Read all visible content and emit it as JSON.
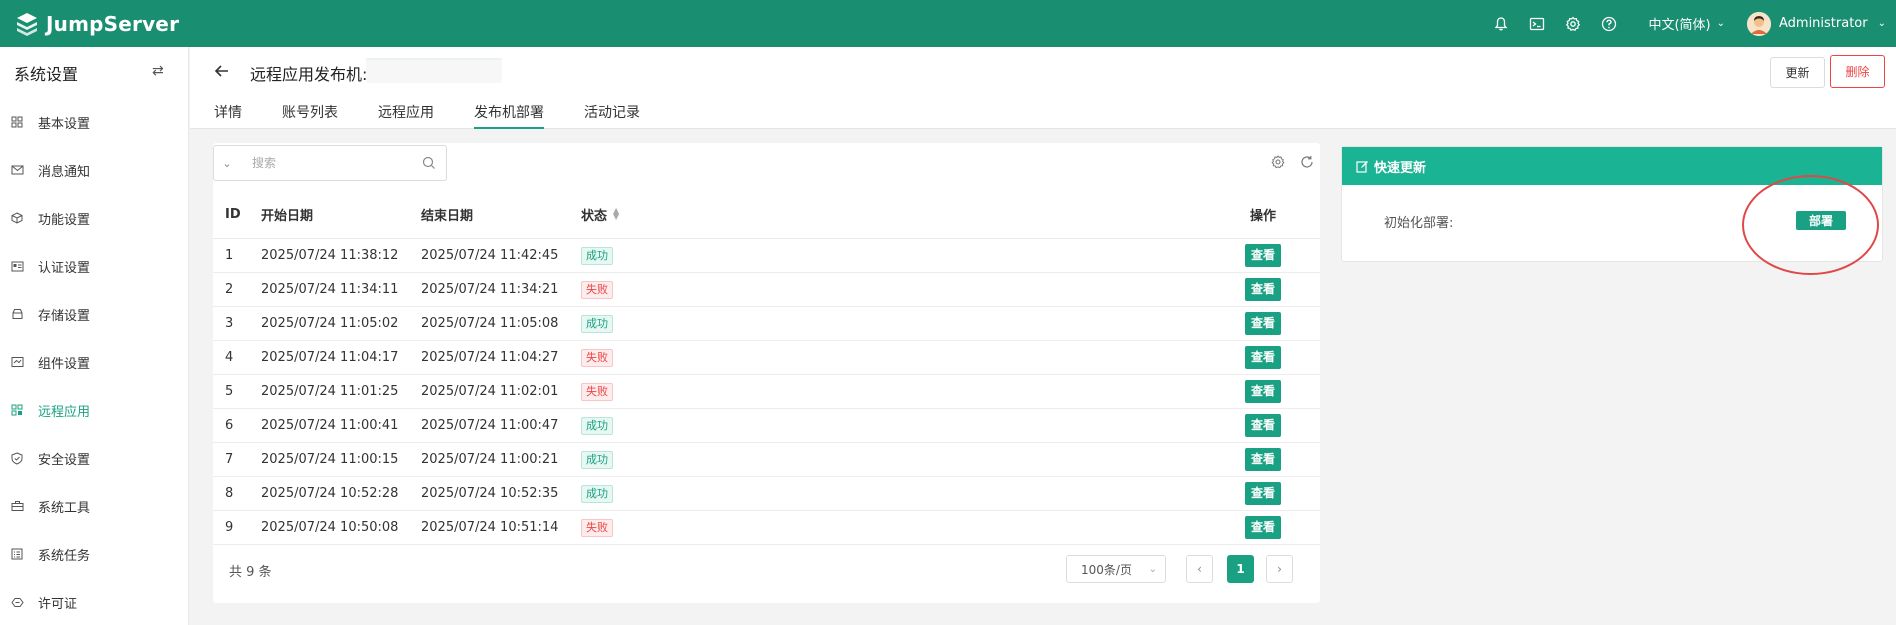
{
  "app": {
    "name": "JumpServer"
  },
  "header": {
    "lang": "中文(简体)",
    "user": "Administrator"
  },
  "sidebar": {
    "title": "系统设置",
    "items": [
      {
        "label": "基本设置",
        "icon": "grid-icon"
      },
      {
        "label": "消息通知",
        "icon": "mail-icon"
      },
      {
        "label": "功能设置",
        "icon": "cube-icon"
      },
      {
        "label": "认证设置",
        "icon": "id-card-icon"
      },
      {
        "label": "存储设置",
        "icon": "storage-icon"
      },
      {
        "label": "组件设置",
        "icon": "component-icon"
      },
      {
        "label": "远程应用",
        "icon": "apps-icon",
        "active": true
      },
      {
        "label": "安全设置",
        "icon": "shield-icon"
      },
      {
        "label": "系统工具",
        "icon": "toolbox-icon"
      },
      {
        "label": "系统任务",
        "icon": "task-icon"
      },
      {
        "label": "许可证",
        "icon": "license-icon"
      }
    ]
  },
  "page": {
    "title": "远程应用发布机:",
    "update_label": "更新",
    "delete_label": "删除",
    "tabs": [
      "详情",
      "账号列表",
      "远程应用",
      "发布机部署",
      "活动记录"
    ],
    "active_tab": 3
  },
  "table": {
    "search_placeholder": "搜索",
    "columns": {
      "id": "ID",
      "start": "开始日期",
      "end": "结束日期",
      "status": "状态",
      "op": "操作"
    },
    "view_label": "查看",
    "rows": [
      {
        "id": "1",
        "start": "2025/07/24 11:38:12",
        "end": "2025/07/24 11:42:45",
        "status": "成功",
        "ok": true
      },
      {
        "id": "2",
        "start": "2025/07/24 11:34:11",
        "end": "2025/07/24 11:34:21",
        "status": "失败",
        "ok": false
      },
      {
        "id": "3",
        "start": "2025/07/24 11:05:02",
        "end": "2025/07/24 11:05:08",
        "status": "成功",
        "ok": true
      },
      {
        "id": "4",
        "start": "2025/07/24 11:04:17",
        "end": "2025/07/24 11:04:27",
        "status": "失败",
        "ok": false
      },
      {
        "id": "5",
        "start": "2025/07/24 11:01:25",
        "end": "2025/07/24 11:02:01",
        "status": "失败",
        "ok": false
      },
      {
        "id": "6",
        "start": "2025/07/24 11:00:41",
        "end": "2025/07/24 11:00:47",
        "status": "成功",
        "ok": true
      },
      {
        "id": "7",
        "start": "2025/07/24 11:00:15",
        "end": "2025/07/24 11:00:21",
        "status": "成功",
        "ok": true
      },
      {
        "id": "8",
        "start": "2025/07/24 10:52:28",
        "end": "2025/07/24 10:52:35",
        "status": "成功",
        "ok": true
      },
      {
        "id": "9",
        "start": "2025/07/24 10:50:08",
        "end": "2025/07/24 10:51:14",
        "status": "失败",
        "ok": false
      }
    ],
    "total": "共 9 条",
    "page_size": "100条/页",
    "current_page": "1"
  },
  "quick": {
    "title": "快速更新",
    "label": "初始化部署:",
    "deploy_label": "部署"
  },
  "colors": {
    "header": "#1a8e70",
    "accent": "#1aa183",
    "danger": "#e44444",
    "quick_head": "#1ab394"
  }
}
